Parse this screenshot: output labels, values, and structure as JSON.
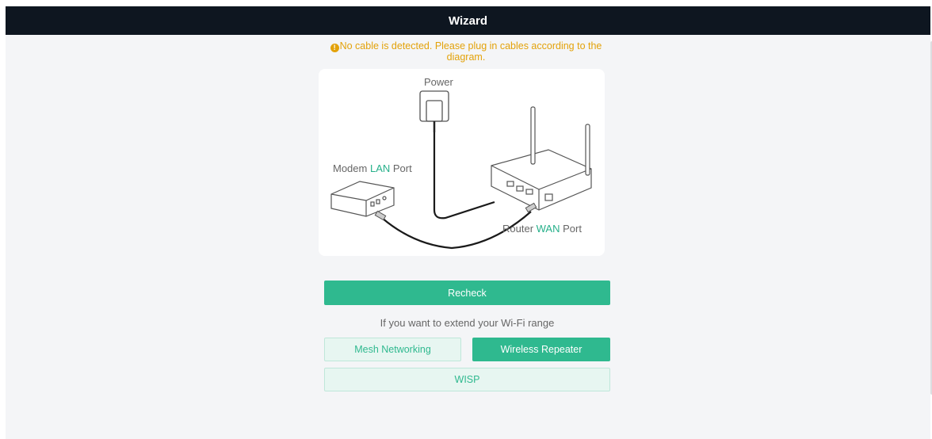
{
  "window": {
    "title": "Wizard"
  },
  "warning": {
    "icon": "warning-circle-icon",
    "color": "#e3a20a",
    "text": "No cable is detected. Please plug in cables according to the diagram."
  },
  "diagram": {
    "power_label": "Power",
    "modem_label_prefix": "Modem ",
    "modem_label_highlight": "LAN",
    "modem_label_suffix": " Port",
    "router_label_prefix": "Router ",
    "router_label_highlight": "WAN",
    "router_label_suffix": " Port",
    "highlight_color": "#26b08a"
  },
  "actions": {
    "recheck_label": "Recheck",
    "extend_hint": "If you want to extend your Wi-Fi range",
    "mesh_label": "Mesh Networking",
    "repeater_label": "Wireless Repeater",
    "wisp_label": "WISP"
  },
  "colors": {
    "accent": "#2fb98f",
    "titlebar": "#0e1620"
  }
}
